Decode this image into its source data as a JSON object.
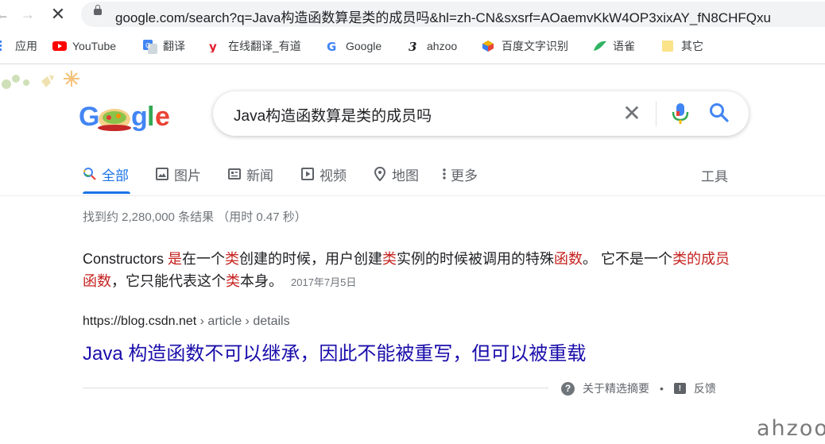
{
  "browser": {
    "url": "google.com/search?q=Java构造函数算是类的成员吗&hl=zh-CN&sxsrf=AOaemvKkW4OP3xixAY_fN8CHFQxu",
    "bookmarks": [
      {
        "label": "应用",
        "icon": "apps-icon"
      },
      {
        "label": "YouTube",
        "icon": "youtube-icon"
      },
      {
        "label": "翻译",
        "icon": "translate-icon"
      },
      {
        "label": "在线翻译_有道",
        "icon": "youdao-icon"
      },
      {
        "label": "Google",
        "icon": "google-icon"
      },
      {
        "label": "ahzoo",
        "icon": "ahzoo-icon"
      },
      {
        "label": "百度文字识别",
        "icon": "baidu-ocr-icon"
      },
      {
        "label": "语雀",
        "icon": "yuque-icon"
      },
      {
        "label": "其它",
        "icon": "folder-icon"
      }
    ]
  },
  "search": {
    "logo": "Google",
    "query": "Java构造函数算是类的成员吗"
  },
  "tabs": [
    {
      "label": "全部",
      "icon": "search-icon",
      "active": true
    },
    {
      "label": "图片",
      "icon": "image-icon"
    },
    {
      "label": "新闻",
      "icon": "news-icon"
    },
    {
      "label": "视频",
      "icon": "video-icon"
    },
    {
      "label": "地图",
      "icon": "map-pin-icon"
    },
    {
      "label": "更多",
      "icon": "more-vert-icon"
    }
  ],
  "tools_label": "工具",
  "stats": "找到约 2,280,000 条结果 （用时 0.47 秒）",
  "featured": {
    "snippet_parts": [
      {
        "t": "Constructors ",
        "hl": false
      },
      {
        "t": "是",
        "hl": true
      },
      {
        "t": "在一个",
        "hl": false
      },
      {
        "t": "类",
        "hl": true
      },
      {
        "t": "创建的时候，用户创建",
        "hl": false
      },
      {
        "t": "类",
        "hl": true
      },
      {
        "t": "实例的时候被调用的特殊",
        "hl": false
      },
      {
        "t": "函数",
        "hl": true
      },
      {
        "t": "。 它不是一个",
        "hl": false
      },
      {
        "t": "类的成员函数",
        "hl": true
      },
      {
        "t": "，它只能代表这个",
        "hl": false
      },
      {
        "t": "类",
        "hl": true
      },
      {
        "t": "本身。",
        "hl": false
      }
    ],
    "date": "2017年7月5日",
    "cite_domain": "https://blog.csdn.net",
    "cite_path": " › article › details",
    "title": "Java 构造函数不可以继承，因此不能被重写，但可以被重载",
    "about_label": "关于精选摘要",
    "feedback_label": "反馈"
  },
  "watermark": "ahzoo",
  "colors": {
    "link": "#1a0dab",
    "highlight": "#c5221f",
    "accent": "#1a73e8"
  }
}
